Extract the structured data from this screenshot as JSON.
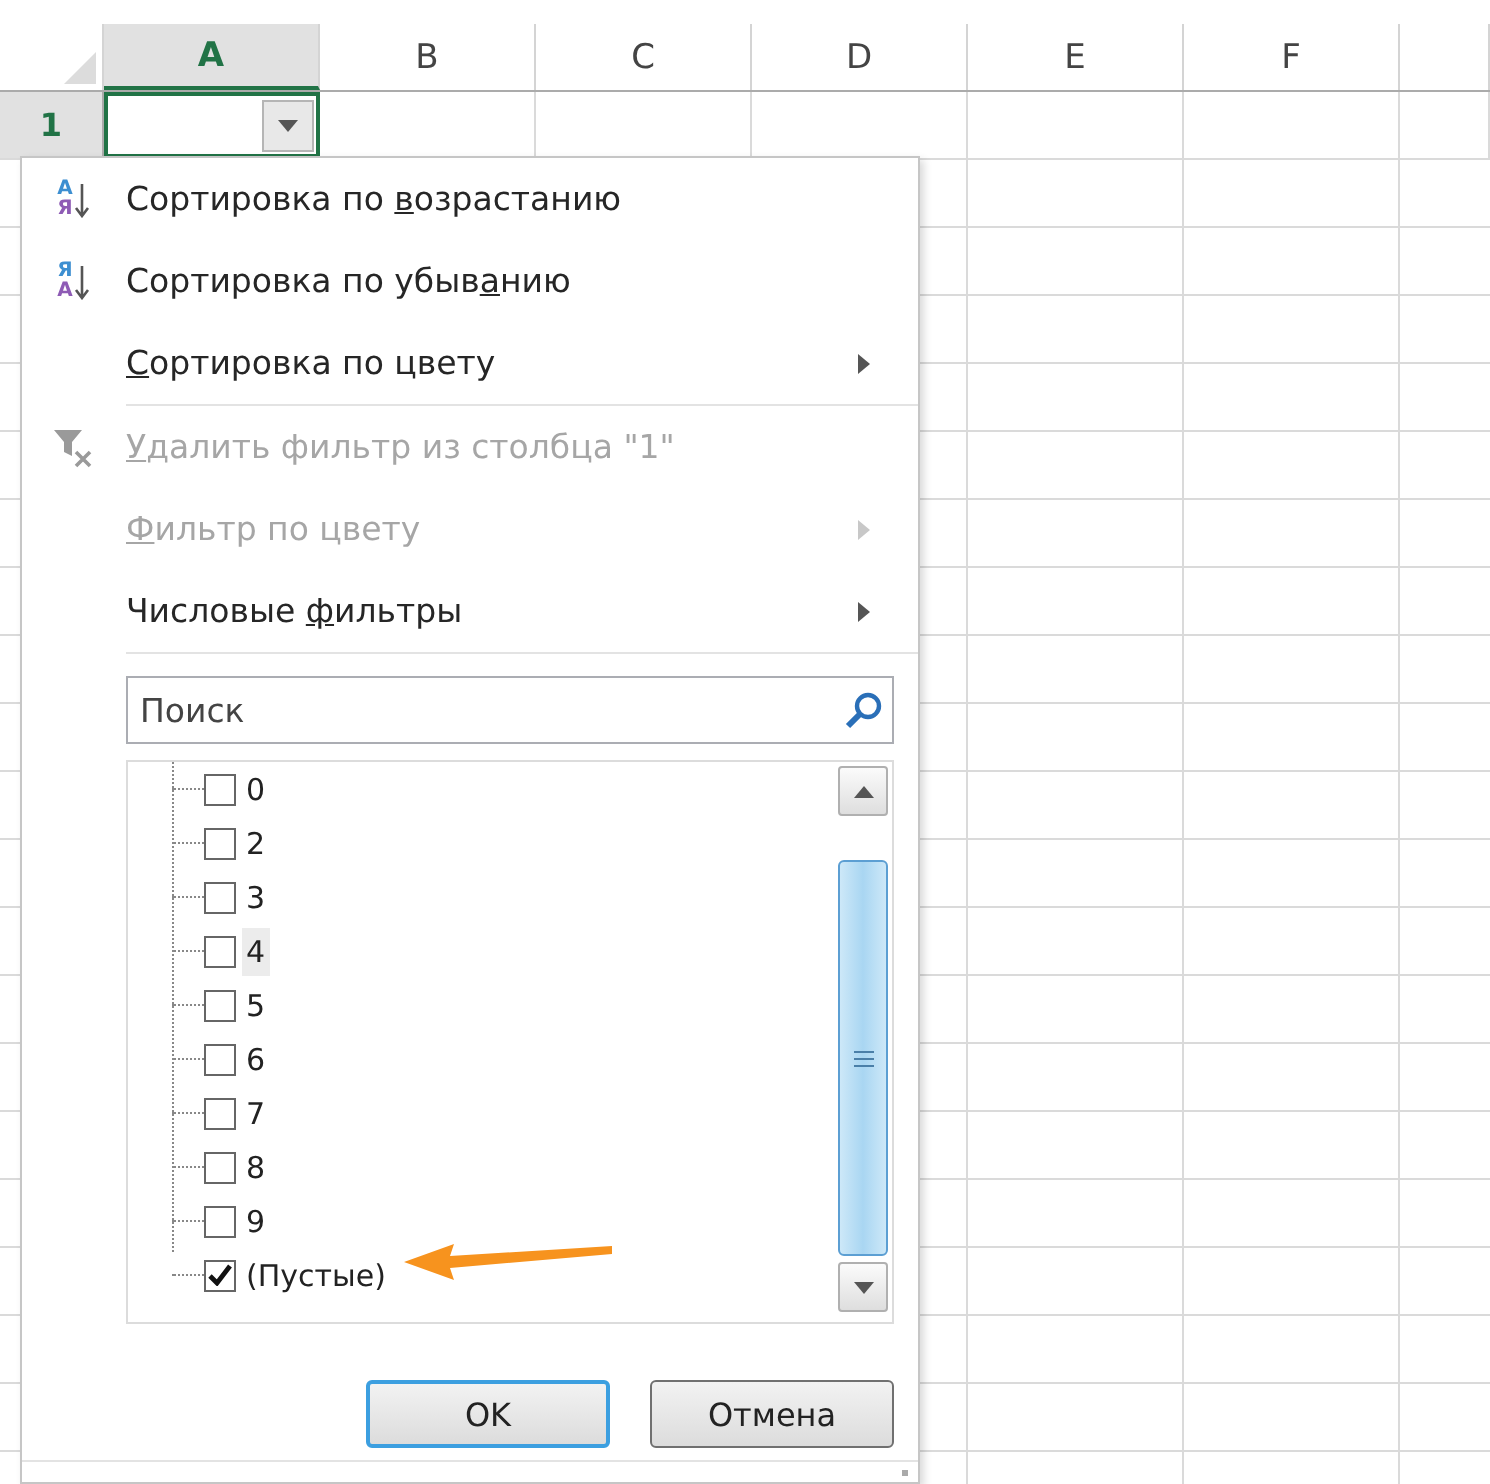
{
  "sheet": {
    "columns": [
      {
        "label": "A",
        "selected": true
      },
      {
        "label": "B",
        "selected": false
      },
      {
        "label": "C",
        "selected": false
      },
      {
        "label": "D",
        "selected": false
      },
      {
        "label": "E",
        "selected": false
      },
      {
        "label": "F",
        "selected": false
      }
    ],
    "rows": [
      {
        "label": "1",
        "selected": true
      }
    ]
  },
  "filter_menu": {
    "items": [
      {
        "kind": "command",
        "icon": {
          "kind": "sort",
          "top": "А",
          "bottom": "Я"
        },
        "label": {
          "before": "Сортировка по ",
          "key": "в",
          "after": "озрастанию"
        },
        "disabled": false,
        "submenu": false
      },
      {
        "kind": "command",
        "icon": {
          "kind": "sort",
          "top": "Я",
          "bottom": "А"
        },
        "label": {
          "before": "Сортировка по убыв",
          "key": "а",
          "after": "нию"
        },
        "disabled": false,
        "submenu": false
      },
      {
        "kind": "command",
        "label": {
          "key": "С",
          "after": "ортировка по цвету"
        },
        "disabled": false,
        "submenu": true
      },
      {
        "kind": "separator"
      },
      {
        "kind": "command",
        "icon": {
          "kind": "clear_filter"
        },
        "label": {
          "key": "У",
          "after": "далить фильтр из столбца \"1\""
        },
        "disabled": true,
        "submenu": false
      },
      {
        "kind": "command",
        "label": {
          "key": "Ф",
          "after": "ильтр по цвету"
        },
        "disabled": true,
        "submenu": true
      },
      {
        "kind": "command",
        "label": {
          "before": "Числовые ",
          "key": "ф",
          "after": "ильтры"
        },
        "disabled": false,
        "submenu": true
      },
      {
        "kind": "separator"
      }
    ],
    "search": {
      "placeholder": "Поиск"
    },
    "values": [
      {
        "label": "0",
        "checked": false,
        "focused": false
      },
      {
        "label": "2",
        "checked": false,
        "focused": false
      },
      {
        "label": "3",
        "checked": false,
        "focused": false
      },
      {
        "label": "4",
        "checked": false,
        "focused": true
      },
      {
        "label": "5",
        "checked": false,
        "focused": false
      },
      {
        "label": "6",
        "checked": false,
        "focused": false
      },
      {
        "label": "7",
        "checked": false,
        "focused": false
      },
      {
        "label": "8",
        "checked": false,
        "focused": false
      },
      {
        "label": "9",
        "checked": false,
        "focused": false
      },
      {
        "label": "(Пустые)",
        "checked": true,
        "focused": false
      }
    ],
    "buttons": [
      {
        "label": "OK",
        "default": true
      },
      {
        "label": "Отмена",
        "default": false
      }
    ]
  }
}
